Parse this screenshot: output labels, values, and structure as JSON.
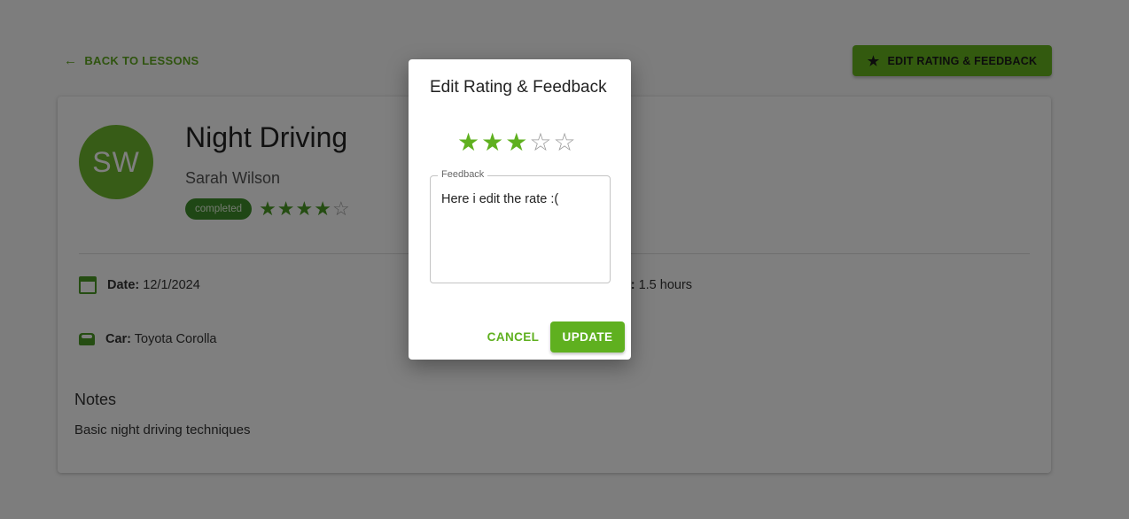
{
  "header": {
    "back_label": "BACK TO LESSONS",
    "edit_button_label": "EDIT RATING & FEEDBACK"
  },
  "lesson": {
    "avatar_initials": "SW",
    "title": "Night Driving",
    "student": "Sarah Wilson",
    "status": "completed",
    "rating": 4,
    "max_rating": 5,
    "date_label": "Date:",
    "date_value": "12/1/2024",
    "duration_label_visible": "on:",
    "duration_value": "1.5 hours",
    "car_label": "Car:",
    "car_value": "Toyota Corolla",
    "notes_title": "Notes",
    "notes_text": "Basic night driving techniques"
  },
  "dialog": {
    "title": "Edit Rating & Feedback",
    "rating": 3,
    "max_rating": 5,
    "feedback_label": "Feedback",
    "feedback_value": "Here i edit the rate :(",
    "cancel_label": "CANCEL",
    "update_label": "UPDATE"
  },
  "colors": {
    "accent": "#5fb01f",
    "status_chip": "#3f8f2a",
    "overlay": "rgba(0,0,0,0.5)"
  },
  "icons": {
    "back": "arrow-left-icon",
    "edit": "star-icon",
    "date": "calendar-icon",
    "car": "car-icon"
  }
}
